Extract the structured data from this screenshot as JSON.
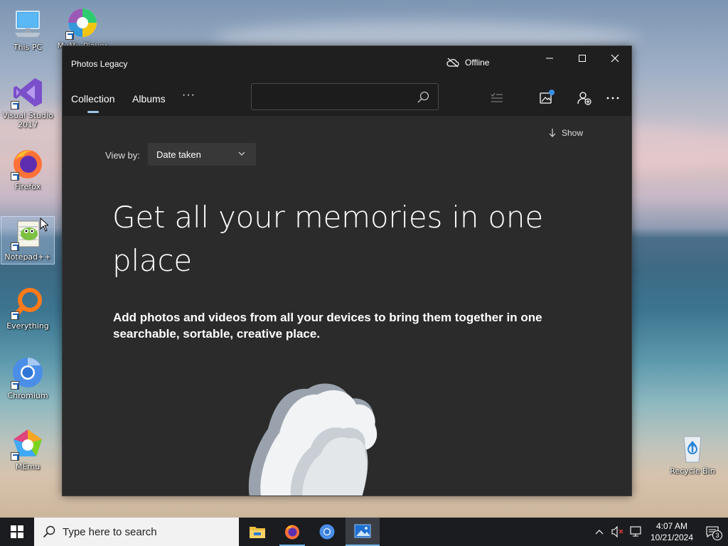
{
  "desktop": {
    "icons": [
      {
        "label": "This PC"
      },
      {
        "label": "MuMu Player"
      },
      {
        "label": "Visual Studio 2017"
      },
      {
        "label": "Firefox"
      },
      {
        "label": "Notepad++"
      },
      {
        "label": "Everything"
      },
      {
        "label": "Chromium"
      },
      {
        "label": "MEmu"
      },
      {
        "label": "Recycle Bin"
      }
    ]
  },
  "window": {
    "title": "Photos Legacy",
    "status": "Offline",
    "controls": {
      "minimize": "minimize",
      "maximize": "maximize",
      "close": "close"
    }
  },
  "nav": {
    "tabs": [
      {
        "label": "Collection",
        "selected": true
      },
      {
        "label": "Albums",
        "selected": false
      }
    ],
    "more": "···",
    "search_placeholder": ""
  },
  "content": {
    "show_label": "Show",
    "view_by_label": "View by:",
    "view_by_value": "Date taken",
    "headline": "Get all your memories in one place",
    "subtext": "Add photos and videos from all your devices to bring them together in one searchable, sortable, creative place."
  },
  "taskbar": {
    "search_placeholder": "Type here to search",
    "apps": [
      "File Explorer",
      "Firefox",
      "Chromium",
      "Photos"
    ],
    "time": "4:07 AM",
    "date": "10/21/2024",
    "notifications": "3"
  },
  "colors": {
    "window_bg": "#2b2b2b",
    "titlebar_bg": "#1f1f1f",
    "accent": "#9fc6ea",
    "taskbar_bg": "#1a1c1f"
  }
}
